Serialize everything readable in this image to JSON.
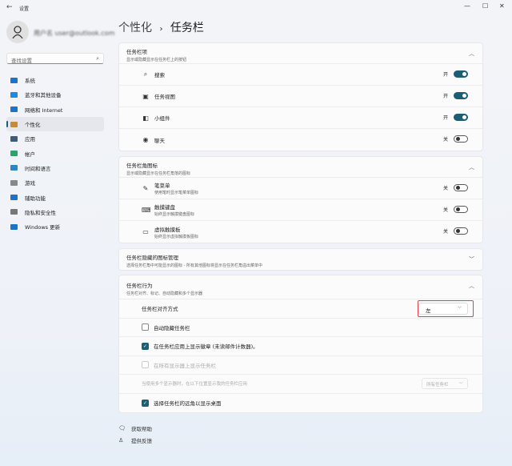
{
  "window": {
    "title": "设置",
    "back": "←",
    "min": "—",
    "max": "☐",
    "close": "✕"
  },
  "user": {
    "name": "用户名 user@outlook.com"
  },
  "search": {
    "placeholder": "查找设置",
    "icon": "search-icon"
  },
  "nav": [
    {
      "label": "系统",
      "color": "#1a75c9"
    },
    {
      "label": "蓝牙和其他设备",
      "color": "#1a8ce0"
    },
    {
      "label": "网络和 Internet",
      "color": "#1a75c9"
    },
    {
      "label": "个性化",
      "color": "#c58a3a"
    },
    {
      "label": "应用",
      "color": "#405a7a"
    },
    {
      "label": "帐户",
      "color": "#2ba36a"
    },
    {
      "label": "时间和语言",
      "color": "#2a86c7"
    },
    {
      "label": "游戏",
      "color": "#888"
    },
    {
      "label": "辅助功能",
      "color": "#1a75c9"
    },
    {
      "label": "隐私和安全性",
      "color": "#777"
    },
    {
      "label": "Windows 更新",
      "color": "#1a75c9"
    }
  ],
  "breadcrumb": {
    "parent": "个性化",
    "sep": "›",
    "current": "任务栏"
  },
  "sections": {
    "items": {
      "title": "任务栏项",
      "subtitle": "显示或隐藏显示在任务栏上的按钮",
      "rows": [
        {
          "label": "搜索",
          "icon": "⌕",
          "state": "开",
          "on": true
        },
        {
          "label": "任务视图",
          "icon": "▣",
          "state": "开",
          "on": true
        },
        {
          "label": "小组件",
          "icon": "◧",
          "state": "开",
          "on": true
        },
        {
          "label": "聊天",
          "icon": "◉",
          "state": "关",
          "on": false
        }
      ]
    },
    "corner": {
      "title": "任务栏角图标",
      "subtitle": "显示或隐藏显示在任务栏角落的图标",
      "rows": [
        {
          "label": "笔菜单",
          "sub": "使用笔时显示笔菜单图标",
          "icon": "✎",
          "state": "关"
        },
        {
          "label": "触摸键盘",
          "sub": "始终显示触摸键盘图标",
          "icon": "⌨",
          "state": "关"
        },
        {
          "label": "虚拟触摸板",
          "sub": "始终显示虚拟触摸板图标",
          "icon": "▭",
          "state": "关"
        }
      ]
    },
    "overflow": {
      "title": "任务栏隐藏的图标管理",
      "subtitle": "选择任务栏角中可能显示的图标 - 所有其他图标将显示在任务栏角溢出菜单中"
    },
    "behavior": {
      "title": "任务栏行为",
      "subtitle": "任务栏对齐、标记、自动隐藏和多个显示器",
      "alignment_label": "任务栏对齐方式",
      "alignment_value": "左",
      "auto_hide": "自动隐藏任务栏",
      "badges": "在任务栏应用上显示徽章 (未读邮件计数器)。",
      "all_displays": "在所有显示器上显示任务栏",
      "multi_label": "当使用多个显示器时，在以下位置显示我的任务栏应用",
      "multi_value": "所有任务栏",
      "far_corner": "选择任务栏的远角以显示桌面"
    }
  },
  "footer": {
    "help": "获取帮助",
    "feedback": "提供反馈"
  }
}
